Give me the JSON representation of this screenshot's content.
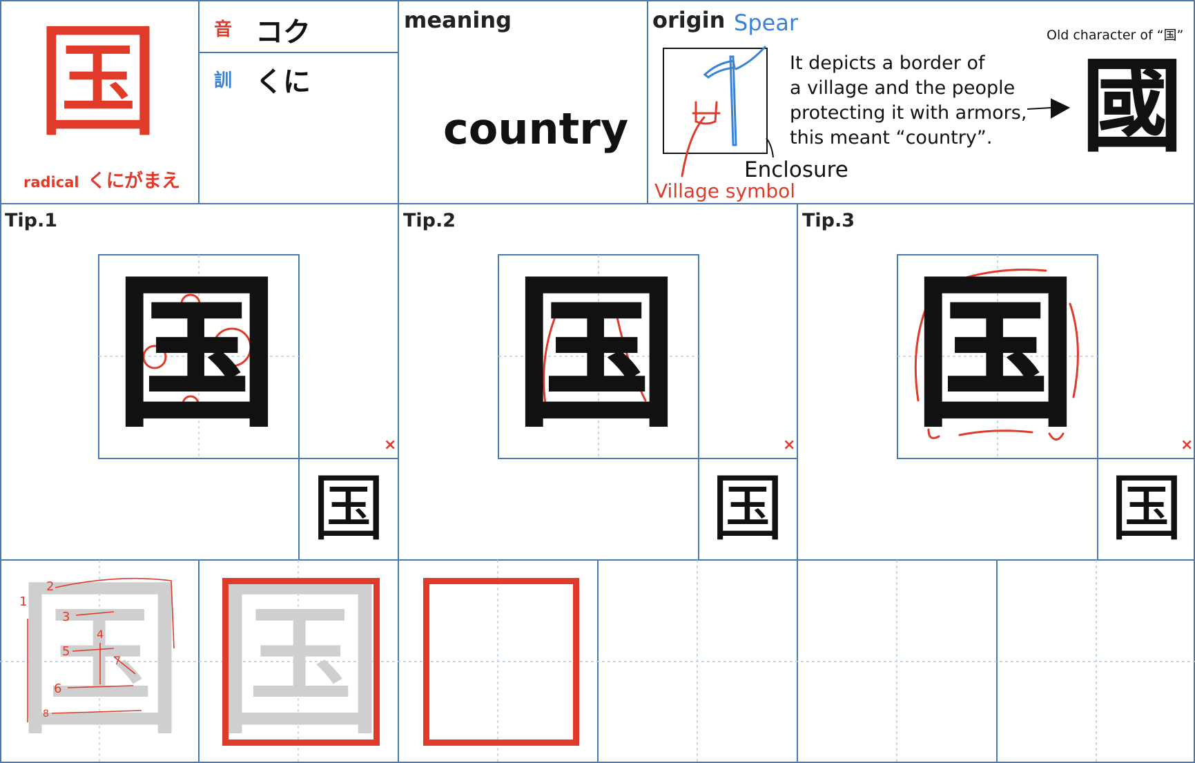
{
  "kanji": "国",
  "old_kanji": "國",
  "readings": {
    "on_label": "音",
    "on_value": "コク",
    "kun_label": "訓",
    "kun_value": "くに"
  },
  "radical": {
    "label": "radical",
    "name": "くにがまえ"
  },
  "meaning": {
    "heading": "meaning",
    "value": "country"
  },
  "origin": {
    "heading": "origin",
    "spear_label": "Spear",
    "enclosure_label": "Enclosure",
    "village_label": "Village symbol",
    "description": [
      "It depicts a border of",
      "a village and the people",
      "protecting it with armors,",
      "this meant “country”."
    ],
    "old_character_caption": "Old character of “国”"
  },
  "tips": [
    {
      "label": "Tip.1",
      "mark": "×"
    },
    {
      "label": "Tip.2",
      "mark": "×"
    },
    {
      "label": "Tip.3",
      "mark": "×"
    }
  ],
  "stroke_numbers": [
    "1",
    "2",
    "3",
    "4",
    "5",
    "6",
    "7",
    "8"
  ],
  "colors": {
    "grid_blue": "#4a78b5",
    "guide_blue": "#b7cde8",
    "accent_red": "#e03a2a",
    "trace_gray": "#cfcfcf",
    "label_blue": "#3a82d6"
  }
}
